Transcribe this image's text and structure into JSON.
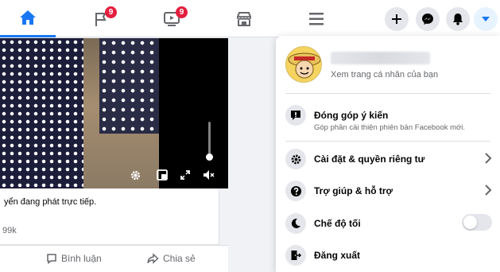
{
  "nav": {
    "tabs": [
      {
        "name": "home-icon",
        "badge": ""
      },
      {
        "name": "pages-flag-icon",
        "badge": "9"
      },
      {
        "name": "watch-video-icon",
        "badge": "9"
      },
      {
        "name": "marketplace-icon",
        "badge": ""
      },
      {
        "name": "menu-icon",
        "badge": ""
      }
    ],
    "right_buttons": [
      "plus-icon",
      "messenger-icon",
      "notifications-bell-icon",
      "account-caret-icon"
    ]
  },
  "feed": {
    "post_text": "yển đang phát trực tiếp.",
    "post_count": "99k",
    "comment_label": "Bình luận",
    "share_label": "Chia sẻ"
  },
  "menu": {
    "profile_sub": "Xem trang cá nhân của bạn",
    "feedback_label": "Đóng góp ý kiến",
    "feedback_sub": "Góp phần cải thiện phiên bản Facebook mới.",
    "settings_label": "Cài đặt & quyền riêng tư",
    "help_label": "Trợ giúp & hỗ trợ",
    "dark_mode_label": "Chế độ tối",
    "logout_label": "Đăng xuất",
    "dark_mode_on": false
  },
  "colors": {
    "accent": "#1877f2",
    "badge": "#e41e3f",
    "secondary_text": "#65676b",
    "button_bg": "#e4e6eb"
  }
}
